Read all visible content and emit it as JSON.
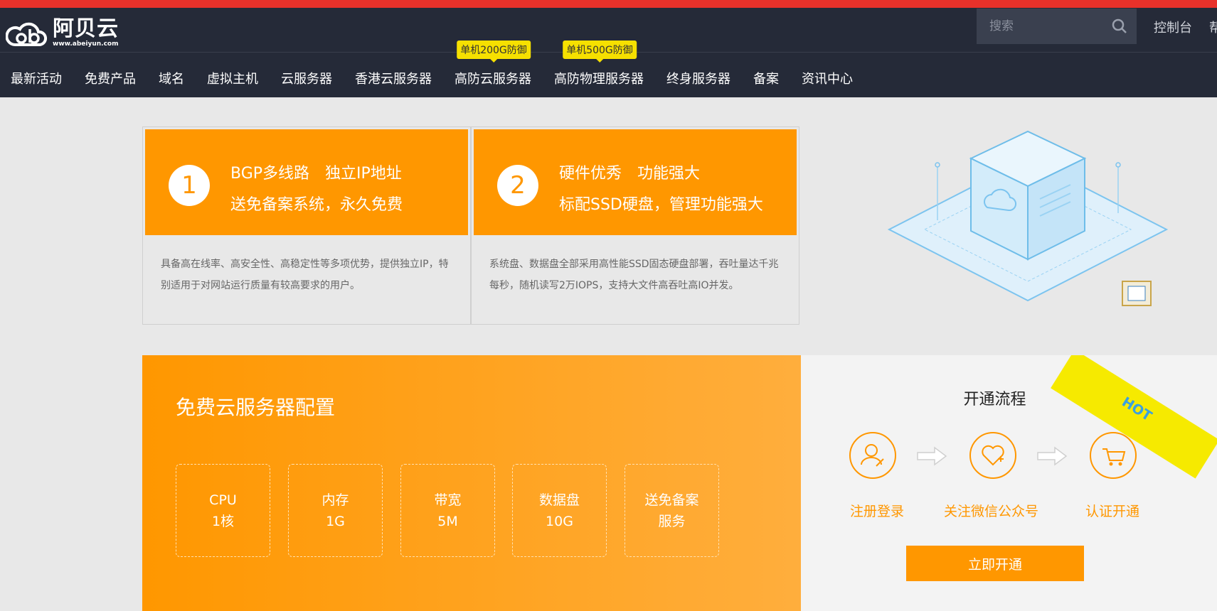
{
  "header": {
    "logo": {
      "name": "阿贝云",
      "url": "www.abeiyun.com"
    },
    "search": {
      "placeholder": "搜索"
    },
    "top_links": [
      "控制台",
      "帮"
    ]
  },
  "nav": {
    "items": [
      {
        "label": "最新活动",
        "badge": ""
      },
      {
        "label": "免费产品",
        "badge": ""
      },
      {
        "label": "域名",
        "badge": ""
      },
      {
        "label": "虚拟主机",
        "badge": ""
      },
      {
        "label": "云服务器",
        "badge": ""
      },
      {
        "label": "香港云服务器",
        "badge": ""
      },
      {
        "label": "高防云服务器",
        "badge": "单机200G防御"
      },
      {
        "label": "高防物理服务器",
        "badge": "单机500G防御"
      },
      {
        "label": "终身服务器",
        "badge": ""
      },
      {
        "label": "备案",
        "badge": ""
      },
      {
        "label": "资讯中心",
        "badge": ""
      }
    ]
  },
  "features": [
    {
      "num": "1",
      "line1": "BGP多线路　独立IP地址",
      "line2": "送免备案系统，永久免费",
      "desc": "具备高在线率、高安全性、高稳定性等多项优势，提供独立IP，特别适用于对网站运行质量有较高要求的用户。"
    },
    {
      "num": "2",
      "line1": "硬件优秀　功能强大",
      "line2": "标配SSD硬盘，管理功能强大",
      "desc": "系统盘、数据盘全部采用高性能SSD固态硬盘部署，吞吐量达千兆每秒，随机读写2万IOPS，支持大文件高吞吐高IO并发。"
    }
  ],
  "free_config": {
    "title": "免费云服务器配置",
    "specs": [
      {
        "line1": "CPU",
        "line2": "1核"
      },
      {
        "line1": "内存",
        "line2": "1G"
      },
      {
        "line1": "带宽",
        "line2": "5M"
      },
      {
        "line1": "数据盘",
        "line2": "10G"
      },
      {
        "line1": "送免备案",
        "line2": "服务"
      }
    ]
  },
  "process": {
    "hot": "HOT",
    "title": "开通流程",
    "steps": [
      "注册登录",
      "关注微信公众号",
      "认证开通"
    ],
    "button": "立即开通"
  },
  "colors": {
    "accent": "#ff9700",
    "header_bg": "#252a38",
    "top_strip": "#e8312a",
    "badge": "#f6e000"
  }
}
